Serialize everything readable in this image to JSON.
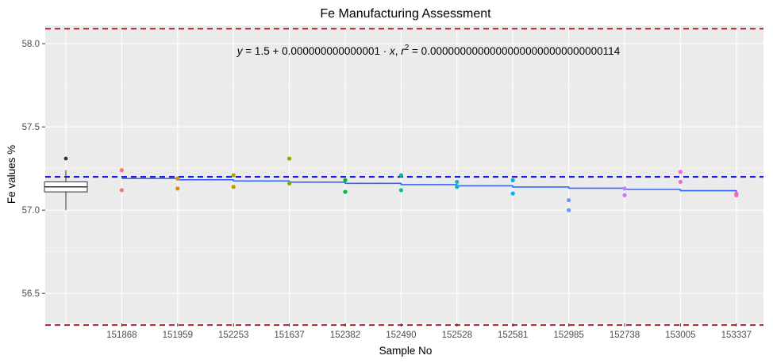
{
  "chart_data": {
    "type": "scatter",
    "title": "Fe Manufacturing Assessment",
    "xlabel": "Sample No",
    "ylabel": "Fe values %",
    "categories": [
      "151868",
      "151959",
      "152253",
      "151637",
      "152382",
      "152490",
      "152528",
      "152581",
      "152985",
      "152738",
      "153005",
      "153337"
    ],
    "ylim": [
      56.32,
      58.11
    ],
    "yticks": [
      56.5,
      57.0,
      57.5,
      58.0
    ],
    "ytick_labels": [
      "56.5",
      "57.0",
      "57.5",
      "58.0"
    ],
    "grid": true,
    "points": [
      {
        "category": "151868",
        "values": [
          57.24,
          57.12
        ],
        "color": "#F8766D"
      },
      {
        "category": "151959",
        "values": [
          57.19,
          57.13
        ],
        "color": "#DE8C00"
      },
      {
        "category": "152253",
        "values": [
          57.21,
          57.14
        ],
        "color": "#B79F00"
      },
      {
        "category": "151637",
        "values": [
          57.31,
          57.16
        ],
        "color": "#7CAE00"
      },
      {
        "category": "152382",
        "values": [
          57.18,
          57.11
        ],
        "color": "#00BA38"
      },
      {
        "category": "152490",
        "values": [
          57.21,
          57.12
        ],
        "color": "#00C08B"
      },
      {
        "category": "152528",
        "values": [
          57.17,
          57.14
        ],
        "color": "#00BFC4"
      },
      {
        "category": "152581",
        "values": [
          57.18,
          57.1
        ],
        "color": "#00B4F0"
      },
      {
        "category": "152985",
        "values": [
          57.06,
          57.0
        ],
        "color": "#619CFF"
      },
      {
        "category": "152738",
        "values": [
          57.13,
          57.09
        ],
        "color": "#C77CFF"
      },
      {
        "category": "153005",
        "values": [
          57.23,
          57.17
        ],
        "color": "#F564E3"
      },
      {
        "category": "153337",
        "values": [
          57.1,
          57.09
        ],
        "color": "#FF64B0"
      }
    ],
    "trend_line": {
      "start": 57.19,
      "end": 57.11,
      "color": "#3366FF"
    },
    "reference_lines": [
      {
        "value": 58.09,
        "color": "#B22222",
        "style": "dashed"
      },
      {
        "value": 57.2,
        "color": "#0000FF",
        "style": "dashed"
      },
      {
        "value": 56.31,
        "color": "#B22222",
        "style": "dashed"
      }
    ],
    "boxplot": {
      "min": 57.0,
      "q1": 57.11,
      "median": 57.14,
      "q3": 57.17,
      "max": 57.24,
      "outlier": 57.31
    },
    "annotation": {
      "y_var": "y",
      "equals": " = 1.5 + 0.000000000000001 · ",
      "x_var": "x",
      "comma": ",  ",
      "r_var": "r",
      "sup": "2",
      "r_value": " = 0.00000000000000000000000000000114"
    }
  }
}
